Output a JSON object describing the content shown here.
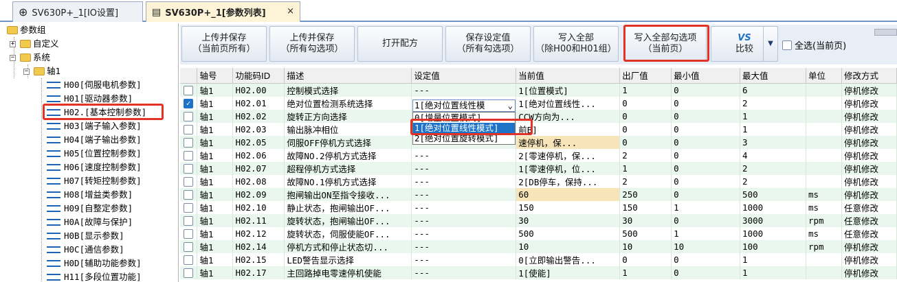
{
  "tabs": {
    "tab1": "SV630P+_1[IO设置]",
    "tab2": "SV630P+_1[参数列表]",
    "close": "×"
  },
  "tree": {
    "root": "参数组",
    "custom": "自定义",
    "system": "系统",
    "axis": "轴1",
    "groups": [
      "H00[伺服电机参数]",
      "H01[驱动器参数]",
      "H02.[基本控制参数]",
      "H03[端子输入参数]",
      "H04[端子输出参数]",
      "H05[位置控制参数]",
      "H06[速度控制参数]",
      "H07[转矩控制参数]",
      "H08[增益类参数]",
      "H09[自整定参数]",
      "H0A[故障与保护]",
      "H0B[显示参数]",
      "H0C[通信参数]",
      "H0D[辅助功能参数]",
      "H11[多段位置功能]"
    ]
  },
  "toolbar": {
    "b1": [
      "上传并保存",
      "（当前页所有）"
    ],
    "b2": [
      "上传并保存",
      "（所有勾选项）"
    ],
    "b3": "打开配方",
    "b4": [
      "保存设定值",
      "（所有勾选项）"
    ],
    "b5": [
      "写入全部",
      "（除H00和H01组）"
    ],
    "b6": [
      "写入全部勾选项",
      "（当前页）"
    ],
    "b7": "比较",
    "b7icon": "VS",
    "selectall": "全选(当前页)"
  },
  "columns": [
    "轴号",
    "功能码ID",
    "描述",
    "设定值",
    "当前值",
    "出厂值",
    "最小值",
    "最大值",
    "单位",
    "修改方式"
  ],
  "rows": [
    [
      "轴1",
      "H02.00",
      "控制模式选择",
      "---",
      "1[位置模式]",
      "1",
      "0",
      "6",
      "",
      "停机修改"
    ],
    [
      "轴1",
      "H02.01",
      "绝对位置检测系统选择",
      "",
      "1[绝对位置线性...",
      "0",
      "0",
      "2",
      "",
      "停机修改"
    ],
    [
      "轴1",
      "H02.02",
      "旋转正方向选择",
      "",
      "CCW方向为...",
      "0",
      "0",
      "1",
      "",
      "停机修改"
    ],
    [
      "轴1",
      "H02.03",
      "输出脉冲相位",
      "",
      "前B]",
      "0",
      "0",
      "1",
      "",
      "停机修改"
    ],
    [
      "轴1",
      "H02.05",
      "伺服OFF停机方式选择",
      "",
      "速停机，保...",
      "0",
      "0",
      "3",
      "",
      "停机修改"
    ],
    [
      "轴1",
      "H02.06",
      "故障NO.2停机方式选择",
      "---",
      "2[零速停机，保...",
      "2",
      "0",
      "4",
      "",
      "停机修改"
    ],
    [
      "轴1",
      "H02.07",
      "超程停机方式选择",
      "---",
      "1[零速停机，位...",
      "1",
      "0",
      "2",
      "",
      "停机修改"
    ],
    [
      "轴1",
      "H02.08",
      "故障NO.1停机方式选择",
      "---",
      "2[DB停车，保持...",
      "2",
      "0",
      "2",
      "",
      "停机修改"
    ],
    [
      "轴1",
      "H02.09",
      "抱闸输出ON至指令接收...",
      "---",
      "60",
      "250",
      "0",
      "500",
      "ms",
      "停机修改"
    ],
    [
      "轴1",
      "H02.10",
      "静止状态，抱闸输出OF...",
      "---",
      "150",
      "150",
      "1",
      "1000",
      "ms",
      "任意修改"
    ],
    [
      "轴1",
      "H02.11",
      "旋转状态，抱闸输出OF...",
      "---",
      "30",
      "30",
      "0",
      "3000",
      "rpm",
      "任意修改"
    ],
    [
      "轴1",
      "H02.12",
      "旋转状态，伺服使能OF...",
      "---",
      "500",
      "500",
      "1",
      "1000",
      "ms",
      "任意修改"
    ],
    [
      "轴1",
      "H02.14",
      "停机方式和停止状态切...",
      "---",
      "10",
      "10",
      "10",
      "100",
      "rpm",
      "停机修改"
    ],
    [
      "轴1",
      "H02.15",
      "LED警告显示选择",
      "---",
      "0[立即输出警告...",
      "0",
      "0",
      "1",
      "",
      "停机修改"
    ],
    [
      "轴1",
      "H02.17",
      "主回路掉电零速停机使能",
      "---",
      "1[使能]",
      "1",
      "0",
      "1",
      "",
      "停机修改"
    ]
  ],
  "dropdown": {
    "selected": "1[绝对位置线性模",
    "arrow": "⌄",
    "options": [
      "0[增量位置模式]",
      "1[绝对位置线性模式]",
      "2[绝对位置旋转模式]"
    ]
  },
  "colors": {
    "accent": "#1e73c8",
    "highlight": "#e23326"
  }
}
